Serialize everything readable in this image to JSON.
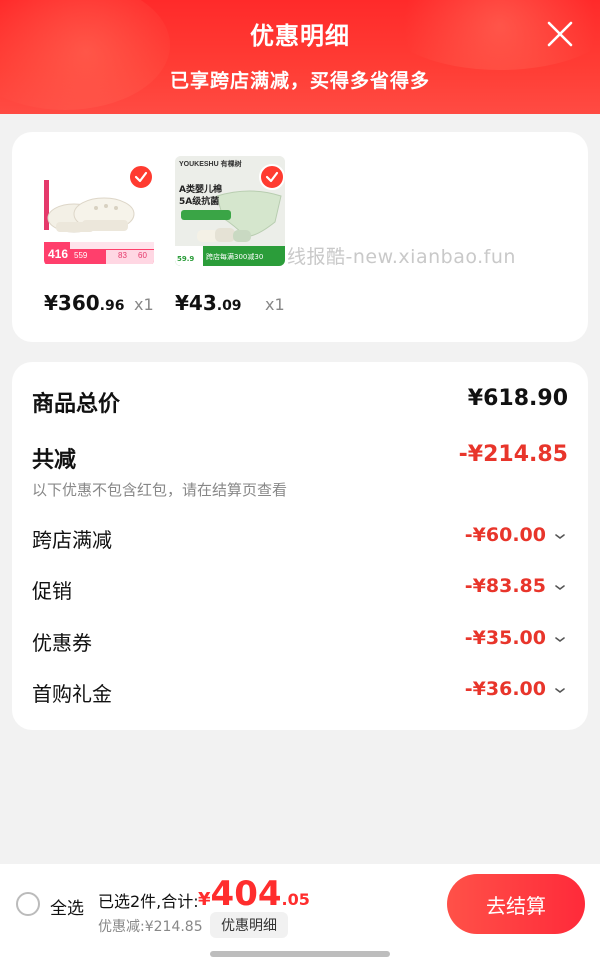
{
  "header": {
    "title": "优惠明细",
    "subtitle": "已享跨店满减，买得多省得多"
  },
  "products": [
    {
      "price_int": "¥360",
      "price_dec": ".96",
      "qty": "x1",
      "thumb": {
        "badge_price": "416",
        "badge_tag_1": "559",
        "badge_tag_2": "83",
        "badge_tag_3": "60"
      }
    },
    {
      "price_int": "¥43",
      "price_dec": ".09",
      "qty": "x1",
      "thumb": {
        "brand": "YOUKESHU 有棵树",
        "line1": "A类婴儿棉",
        "line2": "5A级抗菌",
        "promo": "跨店每满300减30",
        "price": "59.9"
      }
    }
  ],
  "watermark": "线报酷-new.xianbao.fun",
  "summary": {
    "total_label": "商品总价",
    "total_value": "¥618.90",
    "reduce_label": "共减",
    "reduce_value": "-¥214.85",
    "reduce_note": "以下优惠不包含红包，请在结算页查看",
    "items": [
      {
        "label": "跨店满减",
        "value": "-¥60.00"
      },
      {
        "label": "促销",
        "value": "-¥83.85"
      },
      {
        "label": "优惠券",
        "value": "-¥35.00"
      },
      {
        "label": "首购礼金",
        "value": "-¥36.00"
      }
    ]
  },
  "bottom": {
    "select_all": "全选",
    "selected_text": "已选2件,合计:",
    "price_yen": "¥",
    "price_int": "404",
    "price_dec": ".05",
    "discount_text": "优惠减:¥214.85",
    "detail_button": "优惠明细",
    "checkout_button": "去结算"
  },
  "colors": {
    "accent": "#ff2a2a",
    "discount_red": "#e8352b"
  }
}
